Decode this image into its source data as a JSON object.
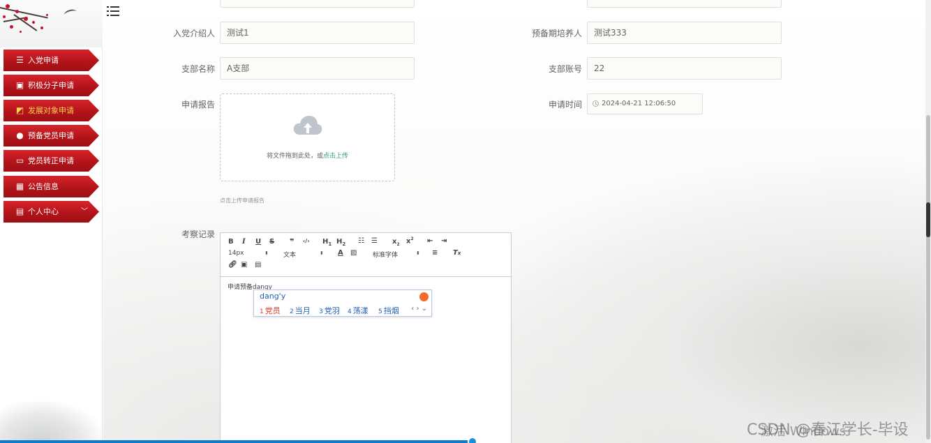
{
  "sidebar": {
    "items": [
      {
        "label": "入党申请",
        "icon": "sliders-icon"
      },
      {
        "label": "积极分子申请",
        "icon": "document-x-icon"
      },
      {
        "label": "发展对象申请",
        "icon": "chart-icon"
      },
      {
        "label": "预备党员申请",
        "icon": "balloon-icon"
      },
      {
        "label": "党员转正申请",
        "icon": "monitor-icon"
      },
      {
        "label": "公告信息",
        "icon": "grid-icon"
      },
      {
        "label": "个人中心",
        "icon": "card-icon",
        "chevron": "﹀"
      }
    ],
    "active_index": 2,
    "active_color": "#f5d251",
    "menu_color": "#c0161d"
  },
  "form": {
    "introducer_label": "入党介绍人",
    "introducer_value": "测试1",
    "trainer_label": "预备期培养人",
    "trainer_value": "测试333",
    "branch_name_label": "支部名称",
    "branch_name_value": "A支部",
    "branch_account_label": "支部账号",
    "branch_account_value": "22",
    "report_label": "申请报告",
    "upload_text": "将文件拖到此处，或",
    "upload_link": "点击上传",
    "upload_tip": "点击上传申请报告",
    "time_label": "申请时间",
    "time_value": "2024-04-21 12:06:50",
    "record_label": "考察记录"
  },
  "editor": {
    "size_select": "14px",
    "type_select": "文本",
    "font_select": "标准字体",
    "content": "申请预备dangy"
  },
  "ime": {
    "input": "dang'y",
    "candidates": [
      {
        "num": "1",
        "text": "党员"
      },
      {
        "num": "2",
        "text": "当月"
      },
      {
        "num": "3",
        "text": "党羽"
      },
      {
        "num": "4",
        "text": "荡漾"
      },
      {
        "num": "5",
        "text": "挡烟"
      }
    ],
    "nav": "‹ › ⌄"
  },
  "watermark": {
    "csdn": "CSDN @春江学长-毕设",
    "windows": "激活 Windows"
  }
}
